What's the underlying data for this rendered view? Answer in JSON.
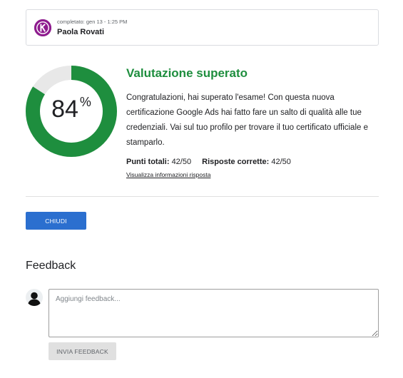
{
  "submission": {
    "completed_label": "completato: gen 13 - 1:25 PM",
    "user_name": "Paola Rovati",
    "logo_icon": "k-logo-icon"
  },
  "score": {
    "value": "84",
    "unit": "%",
    "fraction": 0.84,
    "ring_color": "#1e8e3e",
    "track_color": "#e8e8e8"
  },
  "result": {
    "title": "Valutazione superato",
    "title_color": "#1e8e3e",
    "message": "Congratulazioni, hai superato l'esame! Con questa nuova certificazione Google Ads hai fatto fare un salto di qualità alle tue credenziali. Vai sul tuo profilo per trovare il tuo certificato ufficiale e stamparlo.",
    "total_points_label": "Punti totali:",
    "total_points_value": "42/50",
    "correct_answers_label": "Risposte corrette:",
    "correct_answers_value": "42/50",
    "details_link": "Visualizza informazioni risposta"
  },
  "actions": {
    "close_label": "CHIUDI",
    "close_color": "#2b6fcf"
  },
  "feedback": {
    "heading": "Feedback",
    "placeholder": "Aggiungi feedback...",
    "value": "",
    "submit_label": "INVIA FEEDBACK",
    "avatar_icon": "user-avatar-icon"
  }
}
